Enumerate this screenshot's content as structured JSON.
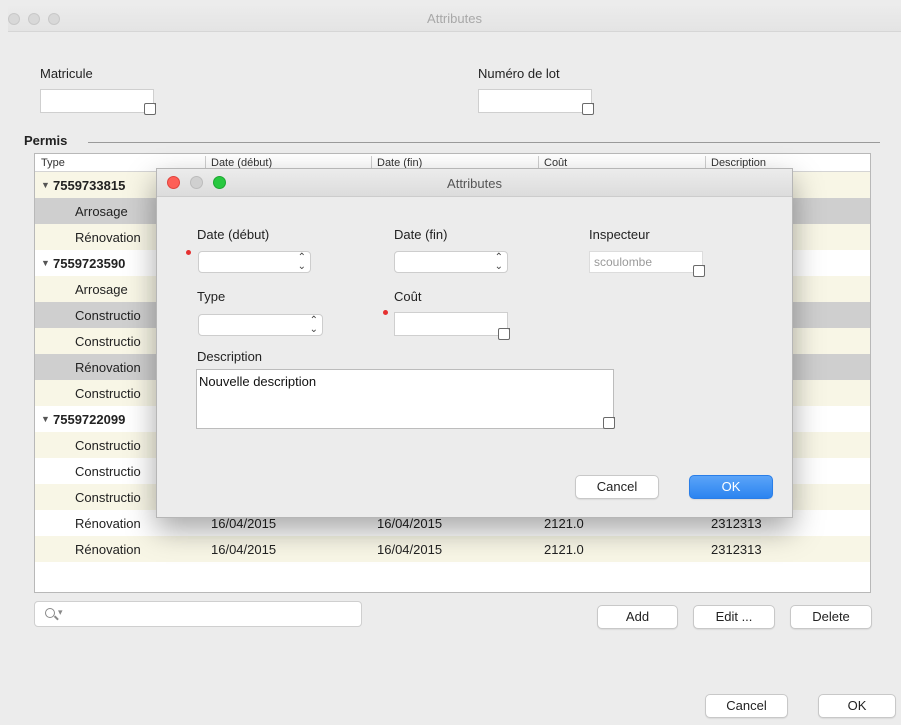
{
  "main_window": {
    "title": "Attributes",
    "matricule_label": "Matricule",
    "matricule_value": "",
    "lot_label": "Numéro de lot",
    "lot_value": "",
    "section_title": "Permis",
    "columns": [
      "Type",
      "Date (début)",
      "Date (fin)",
      "Coût",
      "Description"
    ],
    "rows": [
      {
        "kind": "group",
        "type": "7559733815",
        "date_debut": "",
        "date_fin": "",
        "cout": "",
        "description": ""
      },
      {
        "kind": "item",
        "type": "Arrosage",
        "date_debut": "",
        "date_fin": "",
        "cout": "",
        "description": ""
      },
      {
        "kind": "item",
        "type": "Rénovation",
        "date_debut": "",
        "date_fin": "",
        "cout": "",
        "description": ""
      },
      {
        "kind": "group",
        "type": "7559723590",
        "date_debut": "",
        "date_fin": "",
        "cout": "",
        "description": ""
      },
      {
        "kind": "item",
        "type": "Arrosage",
        "date_debut": "",
        "date_fin": "",
        "cout": "",
        "description": ""
      },
      {
        "kind": "item",
        "type": "Constructio",
        "date_debut": "",
        "date_fin": "",
        "cout": "",
        "description": ""
      },
      {
        "kind": "item",
        "type": "Constructio",
        "date_debut": "",
        "date_fin": "",
        "cout": "",
        "description": ""
      },
      {
        "kind": "item",
        "type": "Rénovation",
        "date_debut": "",
        "date_fin": "",
        "cout": "",
        "description": ""
      },
      {
        "kind": "item",
        "type": "Constructio",
        "date_debut": "",
        "date_fin": "",
        "cout": "",
        "description": ""
      },
      {
        "kind": "group",
        "type": "7559722099",
        "date_debut": "",
        "date_fin": "",
        "cout": "",
        "description": ""
      },
      {
        "kind": "item",
        "type": "Constructio",
        "date_debut": "",
        "date_fin": "",
        "cout": "",
        "description": ""
      },
      {
        "kind": "item",
        "type": "Constructio",
        "date_debut": "",
        "date_fin": "",
        "cout": "",
        "description": ""
      },
      {
        "kind": "item",
        "type": "Constructio",
        "date_debut": "",
        "date_fin": "",
        "cout": "",
        "description": ""
      },
      {
        "kind": "item",
        "type": "Rénovation",
        "date_debut": "16/04/2015",
        "date_fin": "16/04/2015",
        "cout": "2121.0",
        "description": "2312313"
      },
      {
        "kind": "item",
        "type": "Rénovation",
        "date_debut": "16/04/2015",
        "date_fin": "16/04/2015",
        "cout": "2121.0",
        "description": "2312313"
      }
    ],
    "search_placeholder": "",
    "add_label": "Add",
    "edit_label": "Edit ...",
    "delete_label": "Delete",
    "cancel_label": "Cancel",
    "ok_label": "OK"
  },
  "dialog": {
    "title": "Attributes",
    "date_debut_label": "Date (début)",
    "date_fin_label": "Date (fin)",
    "inspecteur_label": "Inspecteur",
    "inspecteur_value": "scoulombe",
    "type_label": "Type",
    "cout_label": "Coût",
    "description_label": "Description",
    "description_value": "Nouvelle description",
    "cancel_label": "Cancel",
    "ok_label": "OK"
  },
  "colors": {
    "required_marker": "#e53030",
    "primary_button": "#2b84f0",
    "selected_row": "#cfcfcf",
    "alternate_row": "#f8f6e6"
  }
}
